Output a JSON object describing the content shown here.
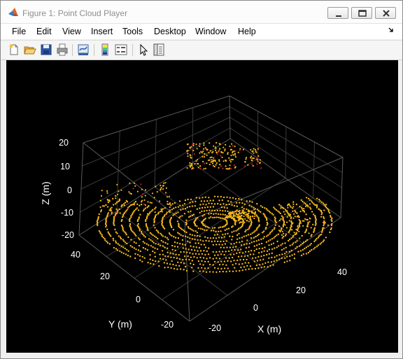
{
  "window": {
    "title": "Figure 1: Point Cloud Player"
  },
  "menu": {
    "items": [
      "File",
      "Edit",
      "View",
      "Insert",
      "Tools",
      "Desktop",
      "Window",
      "Help"
    ]
  },
  "toolbar": {
    "buttons": [
      "new-figure",
      "open-file",
      "save",
      "print",
      "link-plot",
      "insert-colorbar",
      "insert-legend",
      "edit-plot",
      "property-inspector"
    ]
  },
  "axes": {
    "xlabel": "X (m)",
    "ylabel": "Y (m)",
    "zlabel": "Z (m)",
    "x_ticks": [
      "-20",
      "0",
      "20",
      "40"
    ],
    "y_ticks": [
      "-20",
      "0",
      "20",
      "40"
    ],
    "z_ticks": [
      "20",
      "10",
      "0",
      "-10",
      "-20"
    ]
  },
  "colors": {
    "points": "#f5b81b",
    "high_points": "#c21e2a",
    "grid": "#3a3a3a",
    "tick_text": "#ffffff",
    "background": "#000000"
  }
}
